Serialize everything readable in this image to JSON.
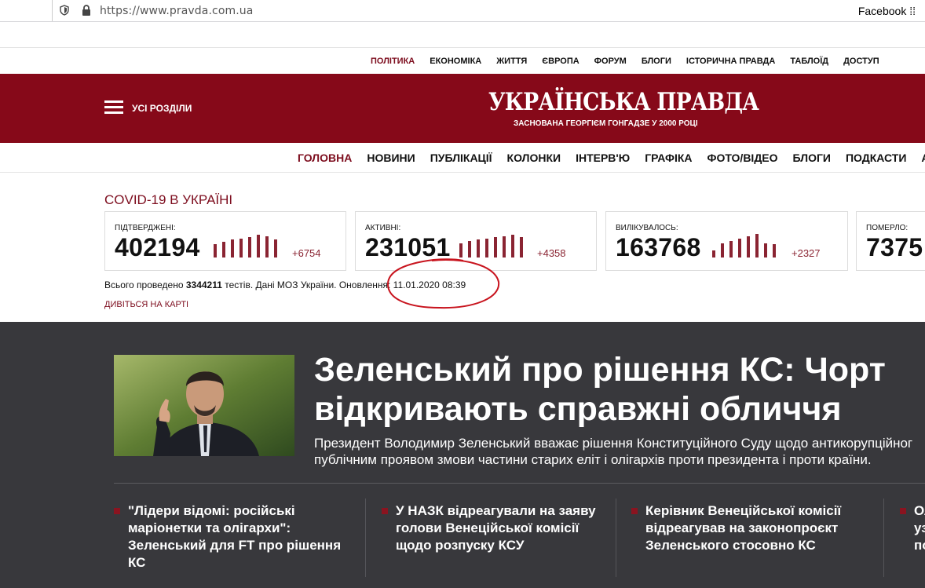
{
  "browser": {
    "url": "https://www.pravda.com.ua",
    "bookmark": "Facebook"
  },
  "topnav": [
    "ПОЛІТИКА",
    "ЕКОНОМІКА",
    "ЖИТТЯ",
    "ЄВРОПА",
    "ФОРУМ",
    "БЛОГИ",
    "ІСТОРИЧНА ПРАВДА",
    "ТАБЛОЇД",
    "ДОСТУП"
  ],
  "header": {
    "all_sections": "УСІ РОЗДІЛИ",
    "logo": "УКРАЇНСЬКА ПРАВДА",
    "slogan": "ЗАСНОВАНА ГЕОРГІЄМ ГОНГАДЗЕ У 2000 РОЦІ"
  },
  "mainnav": [
    "ГОЛОВНА",
    "НОВИНИ",
    "ПУБЛІКАЦІЇ",
    "КОЛОНКИ",
    "ІНТЕРВ'Ю",
    "ГРАФІКА",
    "ФОТО/ВІДЕО",
    "БЛОГИ",
    "ПОДКАСТИ",
    "АРХІВ"
  ],
  "covid": {
    "title": "COVID-19 В УКРАЇНІ",
    "cards": [
      {
        "label": "ПІДТВЕРДЖЕНІ:",
        "value": "402194",
        "delta": "+6754",
        "bars": [
          0.55,
          0.65,
          0.75,
          0.8,
          0.85,
          0.95,
          0.9,
          0.75
        ]
      },
      {
        "label": "АКТИВНІ:",
        "value": "231051",
        "delta": "+4358",
        "bars": [
          0.6,
          0.7,
          0.75,
          0.8,
          0.85,
          0.9,
          0.95,
          0.85
        ]
      },
      {
        "label": "ВИЛІКУВАЛОСЬ:",
        "value": "163768",
        "delta": "+2327",
        "bars": [
          0.3,
          0.6,
          0.7,
          0.8,
          0.9,
          1.0,
          0.6,
          0.55
        ]
      },
      {
        "label": "ПОМЕРЛО:",
        "value": "7375",
        "delta": "",
        "bars": []
      }
    ],
    "tests_prefix": "Всього проведено ",
    "tests_count": "3344211",
    "tests_suffix": " тестів. Дані МОЗ України. Оновлення: 11.01.2020 08:39",
    "map_link": "ДИВІТЬСЯ НА КАРТІ"
  },
  "main_story": {
    "headline_line1": "Зеленський про рішення КС: Чорт",
    "headline_line2": "відкривають справжні обличчя",
    "lead_line1": "Президент Володимир Зеленський вважає рішення Конституційного Суду щодо антикорупційног",
    "lead_line2": "публічним проявом змови частини старих еліт і олігархів проти президента і проти країни."
  },
  "news": [
    {
      "lines": [
        "\"Лідери відомі: російські",
        "маріонетки та олігархи\":",
        "Зеленський для FT про рішення",
        "КС"
      ]
    },
    {
      "lines": [
        "У НАЗК відреагували на заяву",
        "голови Венеційської комісії",
        "щодо розпуску КСУ"
      ]
    },
    {
      "lines": [
        "Керівник Венеційської комісії",
        "відреагував на законопроєкт",
        "Зеленського стосовно КС"
      ]
    },
    {
      "lines": [
        "Ол",
        "уз",
        "по"
      ]
    }
  ],
  "colors": {
    "brand": "#860919",
    "dark_bg": "#38383c",
    "accent": "#7d0d1e"
  }
}
